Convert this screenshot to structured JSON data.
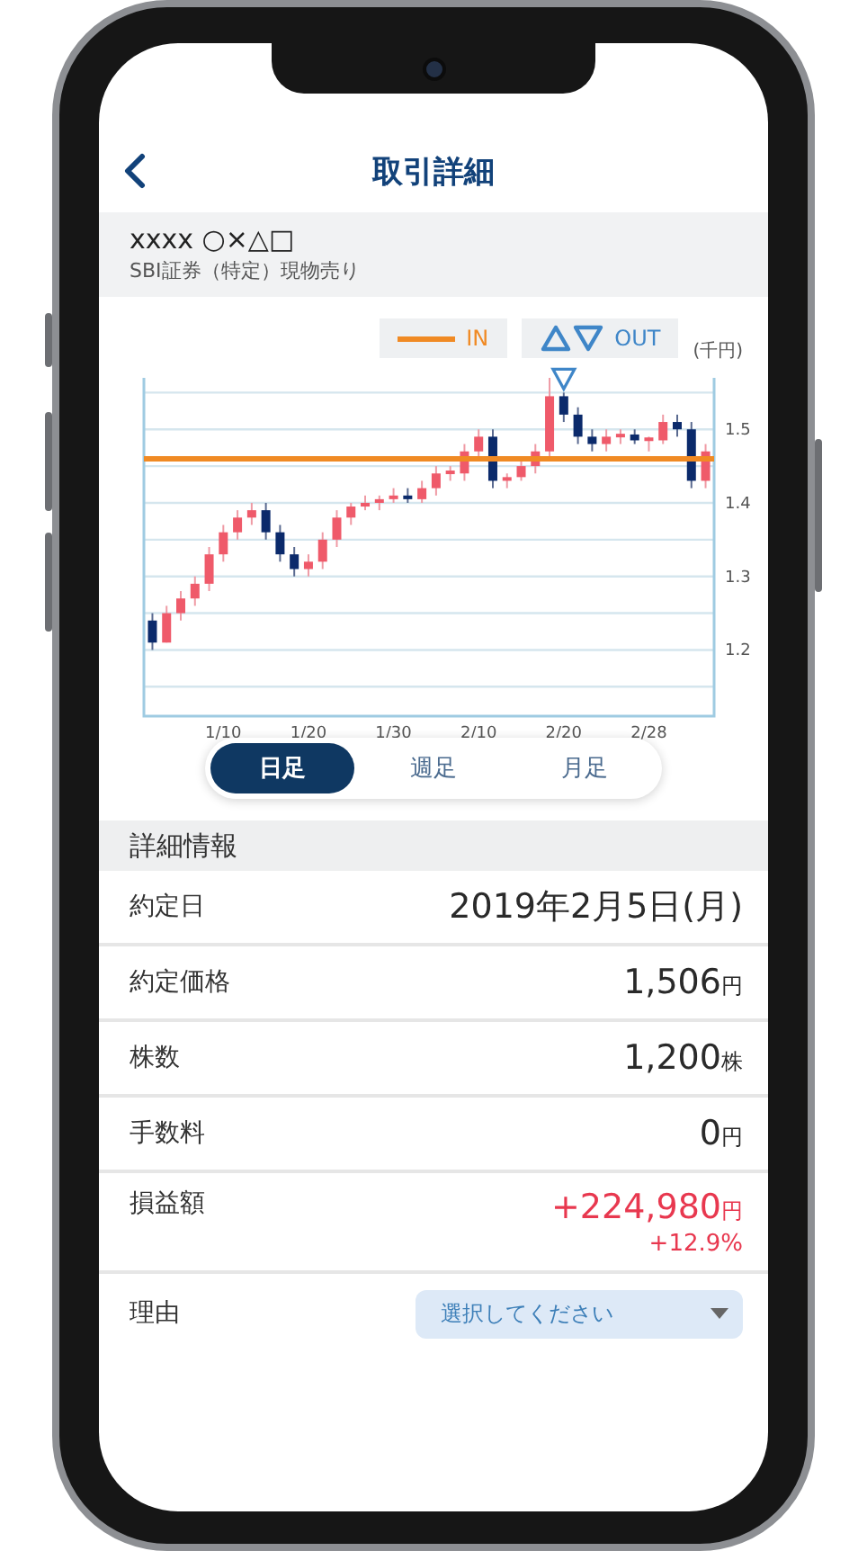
{
  "header": {
    "title": "取引詳細"
  },
  "stock": {
    "name": "xxxx ○×△□",
    "subtitle": "SBI証券（特定）現物売り"
  },
  "chart": {
    "legend": [
      {
        "kind": "line",
        "label": "IN",
        "color": "#f08a24"
      },
      {
        "kind": "triangles",
        "label": "OUT",
        "color": "#3f86c8"
      }
    ],
    "unit": "(千円)",
    "chart_data": {
      "type": "candlestick",
      "categories": [
        null,
        null,
        null,
        null,
        null,
        "1/10",
        null,
        null,
        null,
        null,
        null,
        "1/20",
        null,
        null,
        null,
        null,
        null,
        "1/30",
        null,
        null,
        null,
        null,
        null,
        "2/10",
        null,
        null,
        null,
        null,
        null,
        "2/20",
        null,
        null,
        null,
        null,
        null,
        "2/28",
        null,
        null,
        null,
        null
      ],
      "ohlc": [
        [
          1.24,
          1.25,
          1.2,
          1.21
        ],
        [
          1.21,
          1.26,
          1.21,
          1.25
        ],
        [
          1.25,
          1.28,
          1.24,
          1.27
        ],
        [
          1.27,
          1.3,
          1.26,
          1.29
        ],
        [
          1.29,
          1.34,
          1.28,
          1.33
        ],
        [
          1.33,
          1.37,
          1.32,
          1.36
        ],
        [
          1.36,
          1.39,
          1.35,
          1.38
        ],
        [
          1.38,
          1.4,
          1.37,
          1.39
        ],
        [
          1.39,
          1.4,
          1.35,
          1.36
        ],
        [
          1.36,
          1.37,
          1.32,
          1.33
        ],
        [
          1.33,
          1.34,
          1.3,
          1.31
        ],
        [
          1.31,
          1.33,
          1.3,
          1.32
        ],
        [
          1.32,
          1.36,
          1.31,
          1.35
        ],
        [
          1.35,
          1.39,
          1.34,
          1.38
        ],
        [
          1.38,
          1.4,
          1.37,
          1.395
        ],
        [
          1.395,
          1.41,
          1.39,
          1.4
        ],
        [
          1.4,
          1.41,
          1.39,
          1.405
        ],
        [
          1.405,
          1.42,
          1.4,
          1.41
        ],
        [
          1.41,
          1.42,
          1.4,
          1.405
        ],
        [
          1.405,
          1.43,
          1.4,
          1.42
        ],
        [
          1.42,
          1.45,
          1.41,
          1.44
        ],
        [
          1.44,
          1.45,
          1.43,
          1.443
        ],
        [
          1.44,
          1.48,
          1.43,
          1.47
        ],
        [
          1.47,
          1.5,
          1.46,
          1.49
        ],
        [
          1.49,
          1.5,
          1.42,
          1.43
        ],
        [
          1.43,
          1.44,
          1.42,
          1.435
        ],
        [
          1.435,
          1.46,
          1.43,
          1.45
        ],
        [
          1.45,
          1.48,
          1.44,
          1.47
        ],
        [
          1.47,
          1.57,
          1.46,
          1.545
        ],
        [
          1.545,
          1.55,
          1.51,
          1.52
        ],
        [
          1.52,
          1.53,
          1.48,
          1.49
        ],
        [
          1.49,
          1.5,
          1.47,
          1.48
        ],
        [
          1.48,
          1.5,
          1.47,
          1.49
        ],
        [
          1.49,
          1.5,
          1.48,
          1.493
        ],
        [
          1.493,
          1.5,
          1.48,
          1.485
        ],
        [
          1.485,
          1.49,
          1.47,
          1.488
        ],
        [
          1.485,
          1.52,
          1.48,
          1.51
        ],
        [
          1.51,
          1.52,
          1.49,
          1.5
        ],
        [
          1.5,
          1.51,
          1.42,
          1.43
        ],
        [
          1.43,
          1.48,
          1.42,
          1.47
        ]
      ],
      "ylim": [
        1.11,
        1.57
      ],
      "yticks": [
        1.2,
        1.3,
        1.4,
        1.5
      ],
      "grid": true,
      "ref_lines": [
        {
          "axis": "y",
          "value": 1.46
        }
      ]
    }
  },
  "periods": [
    {
      "label": "日足",
      "selected": true
    },
    {
      "label": "週足",
      "selected": false
    },
    {
      "label": "月足",
      "selected": false
    }
  ],
  "section": "詳細情報",
  "rows": [
    {
      "label": "約定日",
      "value": "2019年2月5日(月)"
    },
    {
      "label": "約定価格",
      "value": "1,506",
      "unit": "円"
    },
    {
      "label": "株数",
      "value": "1,200",
      "unit": "株"
    },
    {
      "label": "手数料",
      "value": "0",
      "unit": "円"
    },
    {
      "label": "損益額",
      "value": "+224,980",
      "unit": "円",
      "sub": "+12.9%",
      "color": "#e8384f"
    }
  ],
  "reason": {
    "label": "理由",
    "placeholder": "選択してください"
  }
}
